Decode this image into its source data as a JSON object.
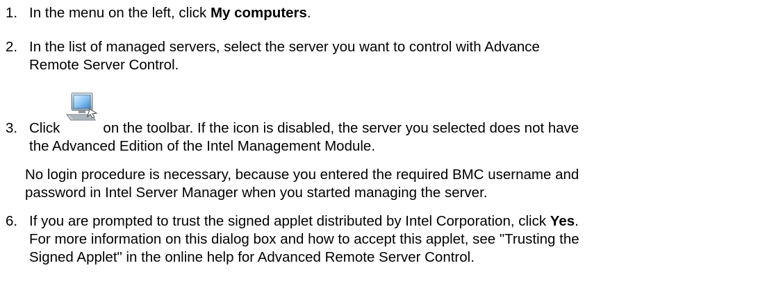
{
  "steps": {
    "s1": {
      "num": "1.",
      "pre": "In the menu on the left, click ",
      "bold": "My computers",
      "post": "."
    },
    "s2": {
      "num": "2.",
      "line1": "In the list of managed servers, select the server you want to control with Advance",
      "line2": "Remote Server Control."
    },
    "s3": {
      "num": "3.",
      "pre": "Click",
      "post": "on the toolbar. If the icon is disabled, the server you selected does not have",
      "line2": "the Advanced Edition of the Intel Management Module.",
      "icon": "computer-remote-icon"
    },
    "note": {
      "line1": "No login procedure is necessary, because you entered the required BMC username and",
      "line2": "password in Intel Server Manager when you started managing the server."
    },
    "s6": {
      "num": "6.",
      "pre": "If you are prompted to trust the signed applet distributed by Intel Corporation, click ",
      "bold": "Yes",
      "post": ".",
      "line2": "For more information on this dialog box and how to accept this applet, see \"Trusting the",
      "line3": "Signed Applet\" in the online help for Advanced Remote Server Control."
    }
  }
}
